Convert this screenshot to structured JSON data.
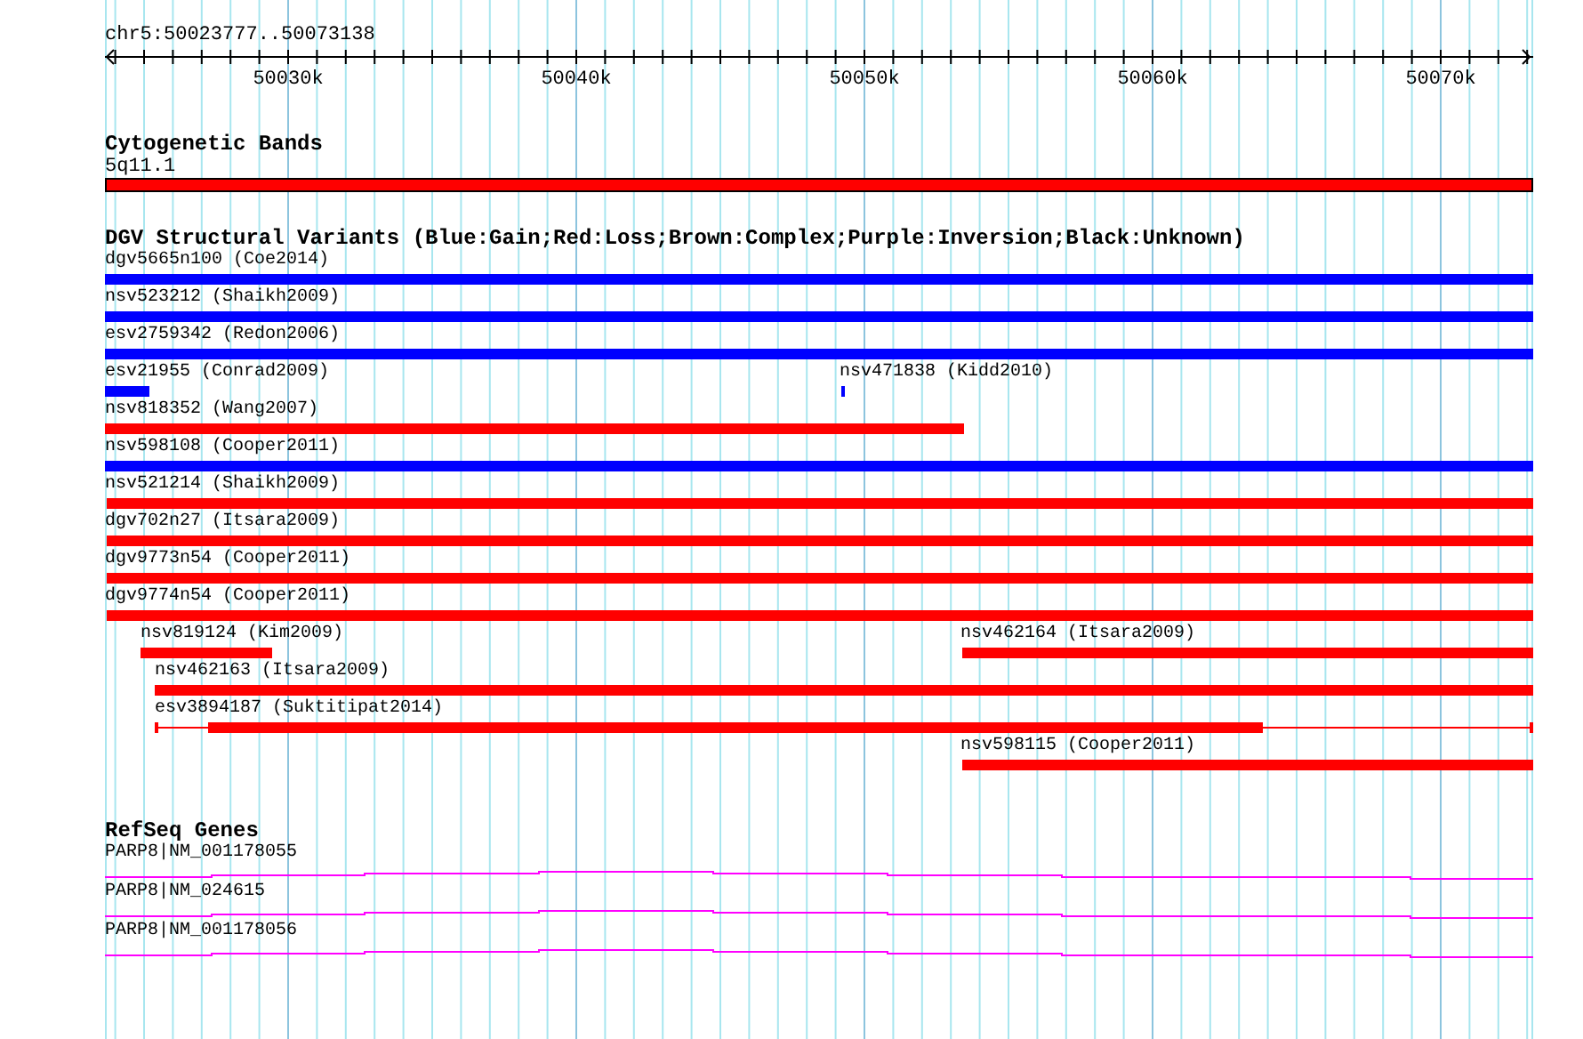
{
  "ruler": {
    "location": "chr5:50023777..50073138",
    "ticks": [
      "50030k",
      "50040k",
      "50050k",
      "50060k",
      "50070k"
    ]
  },
  "cytogenetic_bands": {
    "title": "Cytogenetic Bands",
    "band": {
      "label": "5q11.1"
    }
  },
  "dgv_variants": {
    "title": "DGV Structural Variants (Blue:Gain;Red:Loss;Brown:Complex;Purple:Inversion;Black:Unknown)",
    "rows": [
      {
        "features": [
          {
            "kind": "block",
            "label": "dgv5665n100 (Coe2014)",
            "color": "#0000ff"
          }
        ]
      },
      {
        "features": [
          {
            "kind": "block",
            "label": "nsv523212 (Shaikh2009)",
            "color": "#0000ff"
          }
        ]
      },
      {
        "features": [
          {
            "kind": "block",
            "label": "esv2759342 (Redon2006)",
            "color": "#0000ff"
          }
        ]
      },
      {
        "features": [
          {
            "kind": "block",
            "label": "esv21955 (Conrad2009)",
            "color": "#0000ff"
          },
          {
            "kind": "block",
            "label": "nsv471838 (Kidd2010)",
            "color": "#0000ff"
          }
        ]
      },
      {
        "features": [
          {
            "kind": "block",
            "label": "nsv818352 (Wang2007)",
            "color": "#ff0000"
          }
        ]
      },
      {
        "features": [
          {
            "kind": "block",
            "label": "nsv598108 (Cooper2011)",
            "color": "#0000ff"
          }
        ]
      },
      {
        "features": [
          {
            "kind": "block",
            "label": "nsv521214 (Shaikh2009)",
            "color": "#ff0000"
          }
        ]
      },
      {
        "features": [
          {
            "kind": "block",
            "label": "dgv702n27 (Itsara2009)",
            "color": "#ff0000"
          }
        ]
      },
      {
        "features": [
          {
            "kind": "block",
            "label": "dgv9773n54 (Cooper2011)",
            "color": "#ff0000"
          }
        ]
      },
      {
        "features": [
          {
            "kind": "block",
            "label": "dgv9774n54 (Cooper2011)",
            "color": "#ff0000"
          }
        ]
      },
      {
        "features": [
          {
            "kind": "block",
            "label": "nsv819124 (Kim2009)",
            "color": "#ff0000"
          },
          {
            "kind": "block",
            "label": "nsv462164 (Itsara2009)",
            "color": "#ff0000"
          }
        ]
      },
      {
        "features": [
          {
            "kind": "block",
            "label": "nsv462163 (Itsara2009)",
            "color": "#ff0000"
          }
        ]
      },
      {
        "features": [
          {
            "kind": "split",
            "label": "esv3894187 (Suktitipat2014)",
            "color": "#ff0000"
          }
        ]
      },
      {
        "features": [
          {
            "kind": "block",
            "label": "nsv598115 (Cooper2011)",
            "color": "#ff0000"
          }
        ]
      }
    ]
  },
  "refseq_genes": {
    "title": "RefSeq Genes",
    "transcripts": [
      {
        "label": "PARP8|NM_001178055"
      },
      {
        "label": "PARP8|NM_024615"
      },
      {
        "label": "PARP8|NM_001178056"
      }
    ]
  }
}
